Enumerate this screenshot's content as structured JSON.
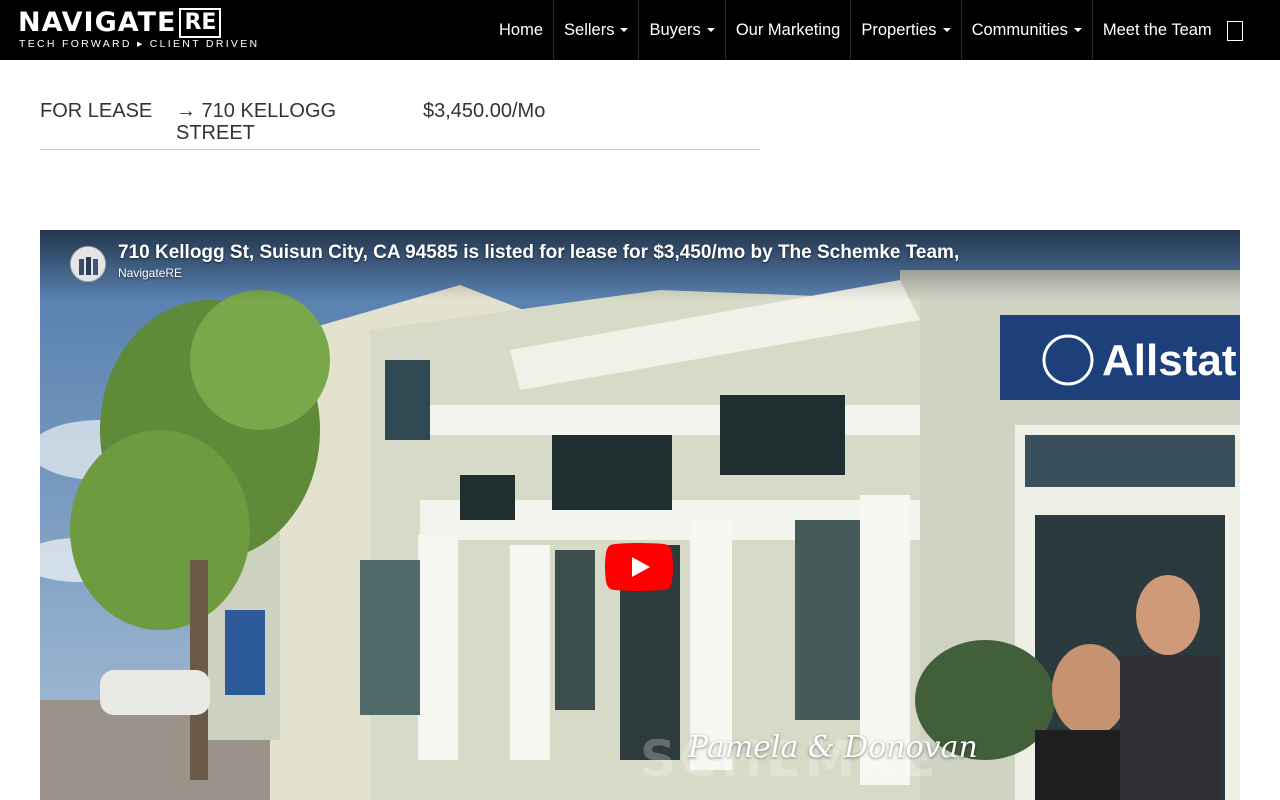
{
  "header": {
    "logo": {
      "word": "NAVIGATE",
      "box": "RE",
      "tagline": "TECH FORWARD ▸ CLIENT DRIVEN"
    },
    "nav": [
      {
        "label": "Home",
        "has_dropdown": false
      },
      {
        "label": "Sellers",
        "has_dropdown": true
      },
      {
        "label": "Buyers",
        "has_dropdown": true
      },
      {
        "label": "Our Marketing",
        "has_dropdown": false
      },
      {
        "label": "Properties",
        "has_dropdown": true
      },
      {
        "label": "Communities",
        "has_dropdown": true
      },
      {
        "label": "Meet the Team",
        "has_dropdown": false
      }
    ],
    "search_icon": "search-icon"
  },
  "listing": {
    "status": "FOR LEASE",
    "address": "→ 710 KELLOGG STREET",
    "price": "$3,450.00/Mo"
  },
  "video": {
    "title": "710 Kellogg St, Suisun City, CA 94585 is listed for lease for $3,450/mo by The Schemke Team,",
    "channel": "NavigateRE",
    "sign_text": "Allstat",
    "signature": "Pamela & Donovan",
    "watermark": "SCHEMKE",
    "play_icon": "youtube-play-icon",
    "colors": {
      "play_red": "#ff0000",
      "sky": "#6a8fb8",
      "building": "#d9dcc9"
    }
  }
}
